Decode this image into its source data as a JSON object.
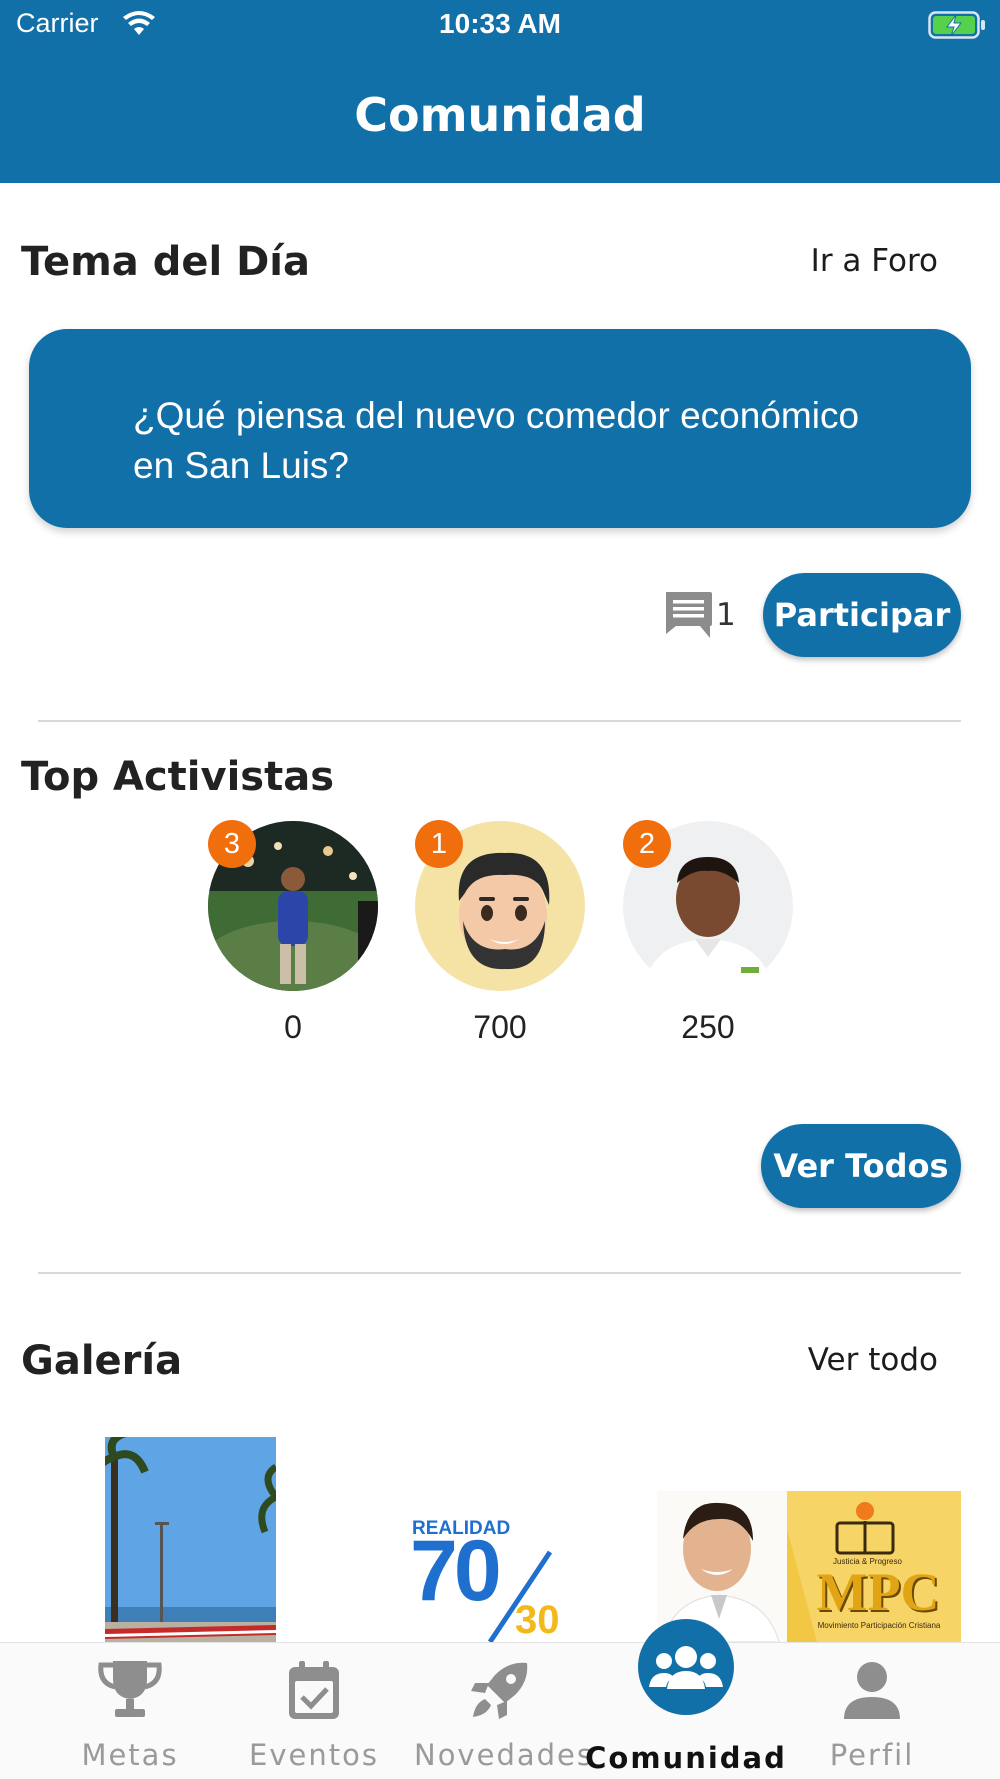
{
  "status": {
    "carrier": "Carrier",
    "time": "10:33 AM"
  },
  "header": {
    "title": "Comunidad"
  },
  "topic": {
    "section_title": "Tema del Día",
    "link": "Ir a Foro",
    "question": "¿Qué piensa del nuevo comedor económico en San Luis?",
    "comment_count": "1",
    "participate_label": "Participar"
  },
  "activists": {
    "section_title": "Top Activistas",
    "items": [
      {
        "rank": "3",
        "points": "0"
      },
      {
        "rank": "1",
        "points": "700"
      },
      {
        "rank": "2",
        "points": "250"
      }
    ],
    "view_all_label": "Ver Todos"
  },
  "gallery": {
    "section_title": "Galería",
    "link": "Ver todo",
    "items": [
      {
        "caption": ""
      },
      {
        "line1": "REALIDAD",
        "big": "70",
        "small": "30"
      },
      {
        "brand": "MPC",
        "subtitle": "Movimiento Participación Cristiana",
        "motto": "Justicia & Progreso"
      }
    ]
  },
  "tabbar": {
    "items": [
      {
        "label": "Metas",
        "icon": "trophy-icon"
      },
      {
        "label": "Eventos",
        "icon": "calendar-check-icon"
      },
      {
        "label": "Novedades",
        "icon": "rocket-icon"
      },
      {
        "label": "Comunidad",
        "icon": "users-icon",
        "active": true
      },
      {
        "label": "Perfil",
        "icon": "user-icon"
      }
    ]
  },
  "colors": {
    "primary": "#1270a8",
    "badge": "#f06e0c",
    "inactive": "#9a9a9a"
  }
}
